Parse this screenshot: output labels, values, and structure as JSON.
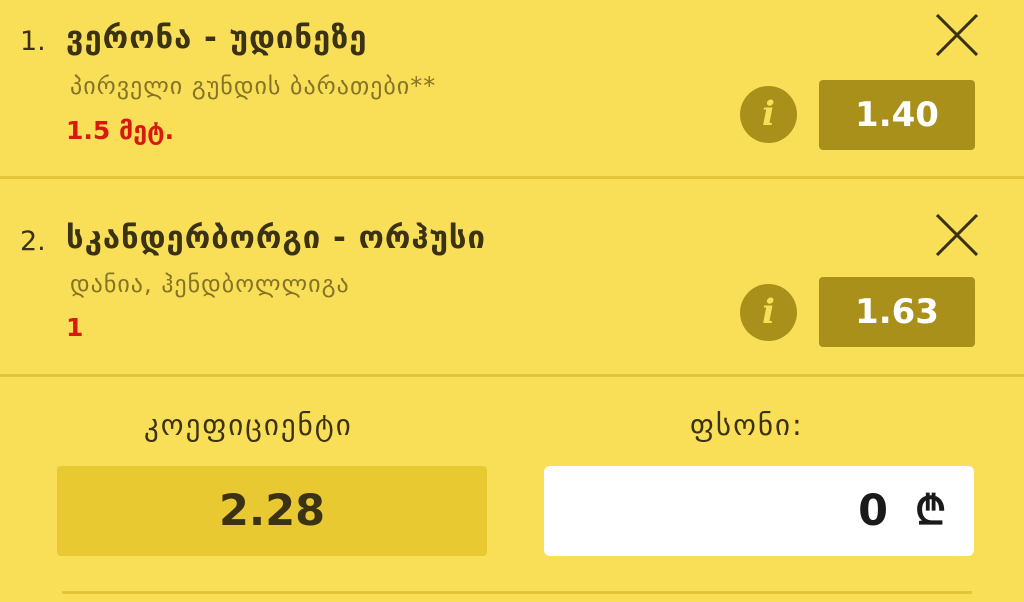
{
  "bets": [
    {
      "number": "1.",
      "match": "ვერონა - უდინეზე",
      "market": "პირველი გუნდის ბარათები**",
      "pick": "1.5 მეტ.",
      "odds": "1.40",
      "info_icon": "info-icon",
      "remove_icon": "close-icon"
    },
    {
      "number": "2.",
      "match": "სკანდერბორგი - ორჰუსი",
      "market": "დანია, ჰენდბოლლიგა",
      "pick": "1",
      "odds": "1.63",
      "info_icon": "info-icon",
      "remove_icon": "close-icon"
    }
  ],
  "summary": {
    "coefficient_label": "კოეფიციენტი",
    "coefficient_value": "2.28",
    "amount_label": "ფსონი:",
    "amount_value": "0",
    "currency_symbol": "₾"
  },
  "colors": {
    "background": "#f9df57",
    "accent": "#a9901a",
    "pick_red": "#d9180f"
  }
}
